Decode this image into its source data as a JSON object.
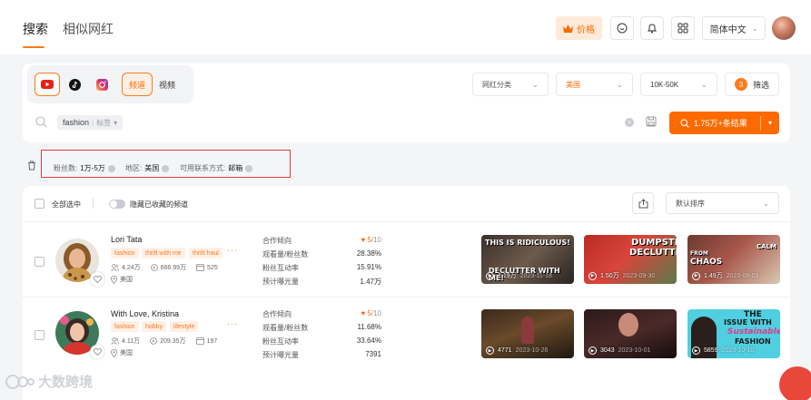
{
  "nav": {
    "tabs": [
      {
        "label": "搜索",
        "active": true
      },
      {
        "label": "相似网红",
        "active": false
      }
    ],
    "price_label": "价格",
    "language": "简体中文",
    "accent": "#ff7a1a"
  },
  "filters": {
    "platforms": [
      "youtube-icon",
      "tiktok-icon",
      "instagram-icon"
    ],
    "selected_platform": "youtube",
    "content_types": [
      "频道",
      "视频"
    ],
    "selected_content_type": "频道",
    "category_dropdown": "网红分类",
    "country_dropdown": "美国",
    "followers_dropdown": "10K-50K",
    "filter_count": "3",
    "filter_label": "筛选"
  },
  "search": {
    "keyword": "fashion",
    "keyword_type": "标签",
    "button_label": "1.75万+条结果"
  },
  "applied_filters": [
    {
      "label": "粉丝数:",
      "value": "1万-5万"
    },
    {
      "label": "地区:",
      "value": "美国"
    },
    {
      "label": "可用联系方式:",
      "value": "邮箱"
    }
  ],
  "list": {
    "select_all": "全部选中",
    "hide_collected": "隐藏已收藏的频道",
    "sort": "默认排序"
  },
  "metric_labels": [
    "合作倾向",
    "观看量/粉丝数",
    "粉丝互动率",
    "预计曝光量"
  ],
  "influencers": [
    {
      "name": "Lori Tata",
      "tags": [
        "fashion",
        "thrift with me",
        "thrift haul"
      ],
      "followers": "4.24万",
      "views": "666.99万",
      "videos": "525",
      "location": "美国",
      "cooperation": "5",
      "cooperation_max": "/10",
      "view_ratio": "28.38%",
      "engagement": "15.91%",
      "exposure": "1.47万",
      "videos_preview": [
        {
          "views": "1.19万",
          "date": "2023-11-18",
          "caption": "THIS IS RIDICULOUS! DECLUTTER WITH ME!"
        },
        {
          "views": "1.50万",
          "date": "2023-09-30",
          "caption": "DUMPSTER DECLUTTER"
        },
        {
          "views": "1.49万",
          "date": "2023-08-09",
          "caption": "FROM CHAOS TO CALM"
        }
      ]
    },
    {
      "name": "With Love, Kristina",
      "tags": [
        "fashion",
        "hobby",
        "lifestyle"
      ],
      "followers": "4.11万",
      "views": "209.35万",
      "videos": "197",
      "location": "美国",
      "cooperation": "5",
      "cooperation_max": "/10",
      "view_ratio": "11.68%",
      "engagement": "33.64%",
      "exposure": "7391",
      "videos_preview": [
        {
          "views": "4771",
          "date": "2023-10-26",
          "caption": ""
        },
        {
          "views": "3043",
          "date": "2023-10-01",
          "caption": ""
        },
        {
          "views": "5859",
          "date": "2023-10-10",
          "caption": "THE ISSUE WITH Sustainable FASHION"
        }
      ]
    }
  ],
  "watermark": "大数跨境"
}
